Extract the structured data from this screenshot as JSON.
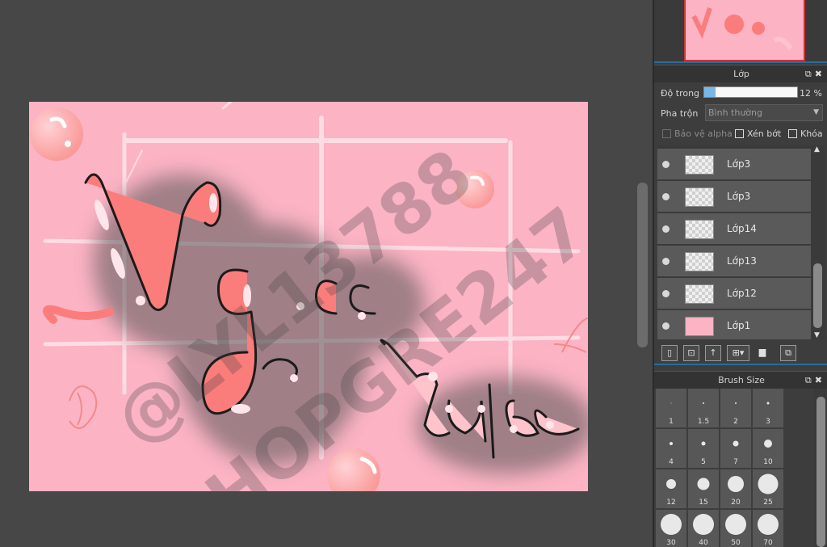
{
  "layer_panel": {
    "title": "Lớp",
    "opacity_label": "Độ trong",
    "opacity_value": "12 %",
    "opacity_fraction": 0.12,
    "blend_label": "Pha trộn",
    "blend_value": "Bình thường",
    "protect_alpha": "Bảo vệ alpha",
    "clipping": "Xén bớt",
    "lock": "Khóa",
    "layers": [
      {
        "name": "Lớp3",
        "thumb": "transparent"
      },
      {
        "name": "Lớp3",
        "thumb": "transparent"
      },
      {
        "name": "Lớp14",
        "thumb": "transparent"
      },
      {
        "name": "Lớp13",
        "thumb": "transparent"
      },
      {
        "name": "Lớp12",
        "thumb": "transparent"
      },
      {
        "name": "Lớp1",
        "thumb": "pink"
      }
    ]
  },
  "brush_panel": {
    "title": "Brush Size",
    "sizes": [
      "1",
      "1.5",
      "2",
      "3",
      "4",
      "5",
      "7",
      "10",
      "12",
      "15",
      "20",
      "25",
      "30",
      "40",
      "50",
      "70"
    ]
  },
  "artwork": {
    "text_top": "Ngọc",
    "text_bottom": "cute",
    "watermark_1": "@LYL13788",
    "watermark_2": "#HOPGRE247",
    "background_color": "#fcb3c4"
  }
}
